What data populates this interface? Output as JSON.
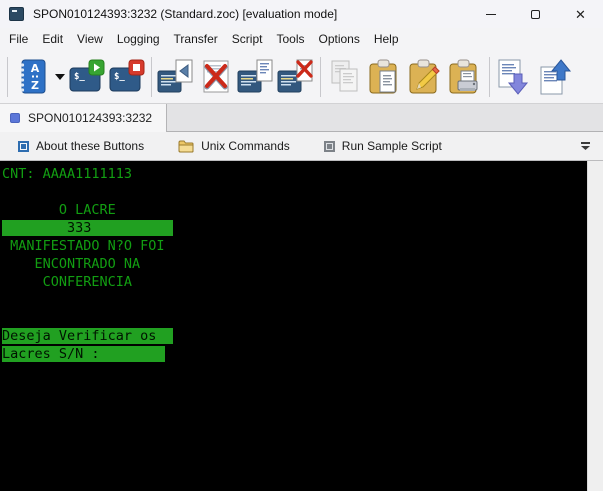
{
  "window": {
    "title": "SPON010124393:3232 (Standard.zoc) [evaluation mode]",
    "app_icon": "terminal-app-icon",
    "controls": {
      "minimize": "minimize",
      "maximize": "maximize",
      "close": "close"
    }
  },
  "menu": {
    "items": [
      "File",
      "Edit",
      "View",
      "Logging",
      "Transfer",
      "Script",
      "Tools",
      "Options",
      "Help"
    ]
  },
  "toolbar": {
    "icons": [
      "address-book",
      "address-book-dropdown",
      "connect-terminal",
      "disconnect-terminal",
      "receive-file",
      "abort-transfer",
      "send-file",
      "abort-send",
      "copy",
      "paste",
      "paste-edit",
      "print-clipboard",
      "download-file",
      "upload-file"
    ]
  },
  "tabstrip": {
    "active_tab": {
      "icon": "session-tab-icon",
      "label": "SPON010124393:3232"
    }
  },
  "buttonbar": {
    "buttons": [
      {
        "icon": "square-button-icon",
        "label": "About these Buttons"
      },
      {
        "icon": "folder-icon",
        "label": "Unix Commands"
      },
      {
        "icon": "square-button-icon",
        "label": "Run Sample Script"
      }
    ],
    "overflow_icon": "chevron-overflow-icon"
  },
  "terminal": {
    "background": "#000000",
    "text_color": "#129e12",
    "highlight_bg": "#21a021",
    "highlight_text": "#001400",
    "lines": [
      {
        "text": "CNT: AAAA1111113",
        "hl": false
      },
      {
        "text": "",
        "hl": false
      },
      {
        "text": "       O LACRE",
        "hl": false
      },
      {
        "text": "        333          ",
        "hl": true
      },
      {
        "text": " MANIFESTADO N?O FOI",
        "hl": false
      },
      {
        "text": "    ENCONTRADO NA",
        "hl": false
      },
      {
        "text": "     CONFERENCIA",
        "hl": false
      },
      {
        "text": "",
        "hl": false
      },
      {
        "text": "",
        "hl": false
      },
      {
        "text": "Deseja Verificar os  ",
        "hl": true
      },
      {
        "text": "Lacres S/N :        ",
        "hl": true
      }
    ]
  }
}
